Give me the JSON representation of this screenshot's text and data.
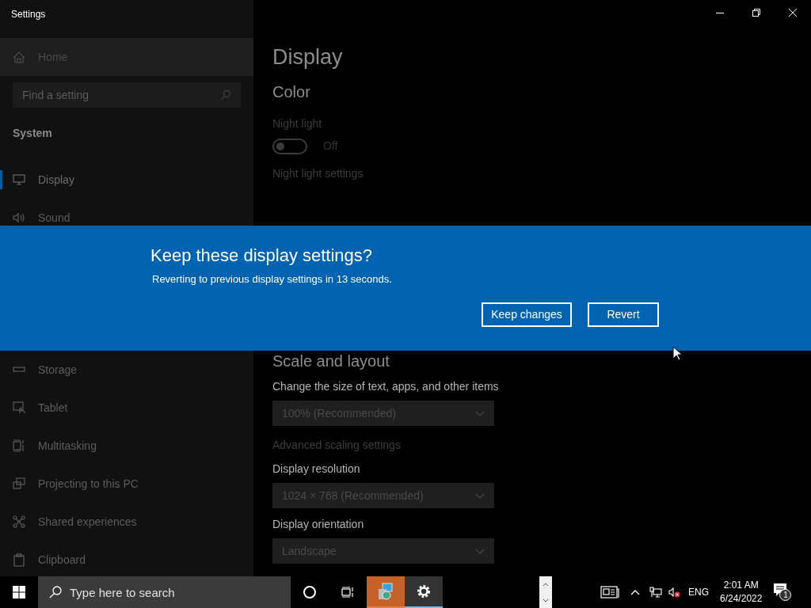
{
  "window": {
    "title": "Settings"
  },
  "sidebar": {
    "home": "Home",
    "search": {
      "placeholder": "Find a setting"
    },
    "section": "System",
    "items_top": [
      {
        "label": "Display",
        "selected": true
      },
      {
        "label": "Sound",
        "selected": false
      }
    ],
    "items_bottom": [
      {
        "label": "Storage",
        "selected": false
      },
      {
        "label": "Tablet",
        "selected": false
      },
      {
        "label": "Multitasking",
        "selected": false
      },
      {
        "label": "Projecting to this PC",
        "selected": false
      },
      {
        "label": "Shared experiences",
        "selected": false
      },
      {
        "label": "Clipboard",
        "selected": false
      }
    ]
  },
  "content": {
    "title": "Display",
    "color_heading": "Color",
    "night_light": {
      "label": "Night light",
      "on": false,
      "state_label": "Off"
    },
    "night_light_link": "Night light settings",
    "scale_heading": "Scale and layout",
    "fields": [
      {
        "label": "Change the size of text, apps, and other items",
        "value": "100% (Recommended)",
        "link": "Advanced scaling settings"
      },
      {
        "label": "Display resolution",
        "value": "1024 × 768 (Recommended)"
      },
      {
        "label": "Display orientation",
        "value": "Landscape"
      }
    ]
  },
  "dialog": {
    "title": "Keep these display settings?",
    "message": "Reverting to previous display settings in 13 seconds.",
    "buttons": [
      "Keep changes",
      "Revert"
    ]
  },
  "taskbar": {
    "search_placeholder": "Type here to search",
    "language": "ENG",
    "time": "2:01 AM",
    "date": "6/24/2022",
    "notifications": "1"
  }
}
